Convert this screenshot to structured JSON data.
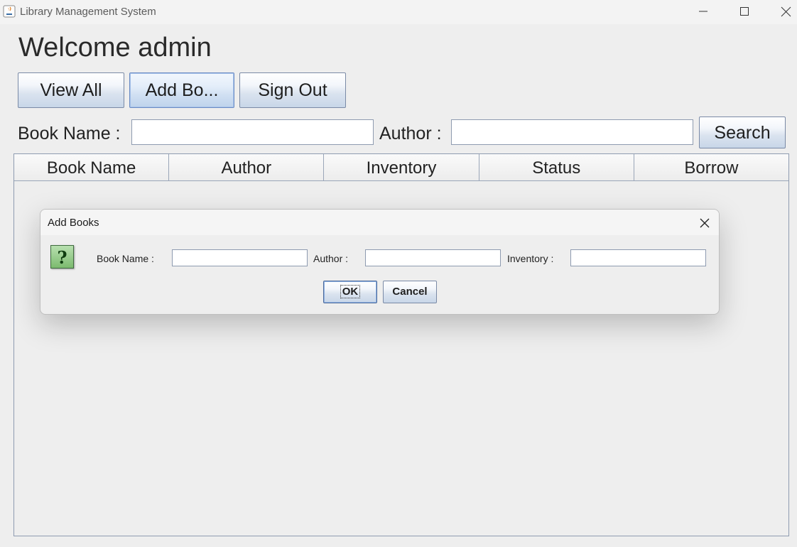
{
  "window": {
    "title": "Library Management System"
  },
  "main": {
    "welcome": "Welcome admin",
    "buttons": {
      "view_all": "View All",
      "add_books": "Add Bo...",
      "sign_out": "Sign Out",
      "search": "Search"
    },
    "search": {
      "book_name_label": "Book Name :",
      "book_name_value": "",
      "author_label": "Author :",
      "author_value": ""
    },
    "table": {
      "columns": [
        "Book Name",
        "Author",
        "Inventory",
        "Status",
        "Borrow"
      ],
      "rows": []
    }
  },
  "dialog": {
    "title": "Add Books",
    "icon": "question-icon",
    "book_name_label": "Book Name :",
    "book_name_value": "",
    "author_label": "Author :",
    "author_value": "",
    "inventory_label": "Inventory :",
    "inventory_value": "",
    "ok_label": "OK",
    "cancel_label": "Cancel"
  },
  "colors": {
    "background": "#eeeeee",
    "button_border": "#7a8aa6",
    "icon_green": "#7cbb6f"
  }
}
